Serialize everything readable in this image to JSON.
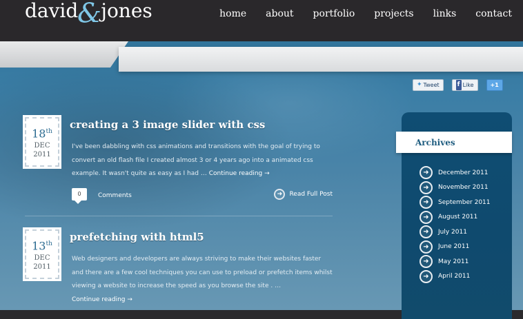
{
  "brand": {
    "logo_first": "david",
    "logo_amp": "&",
    "logo_last": "jones"
  },
  "nav": [
    "home",
    "about",
    "portfolio",
    "projects",
    "links",
    "contact"
  ],
  "social": {
    "tweet": "Tweet",
    "like": "Like",
    "plus": "+1"
  },
  "posts": [
    {
      "day": "18",
      "suffix": "th",
      "month": "DEC",
      "year": "2011",
      "title": "creating a 3 image slider with css",
      "excerpt": "I've been dabbling with css animations and transitions with the goal of trying to convert an old flash file I created almost 3 or 4 years ago into a animated css example. It wasn't quite as easy as I had …",
      "continue": "Continue reading",
      "comment_count": "0",
      "comments_label": "Comments",
      "read_full": "Read Full Post"
    },
    {
      "day": "13",
      "suffix": "th",
      "month": "DEC",
      "year": "2011",
      "title": "prefetching with html5",
      "excerpt": "Web designers and developers are always striving to make their websites faster and there are a few cool techniques you can use to preload or prefetch items whilst viewing a website to increase the speed as you browse the site . …",
      "continue": "Continue reading"
    }
  ],
  "archives": {
    "title": "Archives",
    "items": [
      "December 2011",
      "November 2011",
      "September 2011",
      "August 2011",
      "July 2011",
      "June 2011",
      "May 2011",
      "April 2011"
    ]
  }
}
